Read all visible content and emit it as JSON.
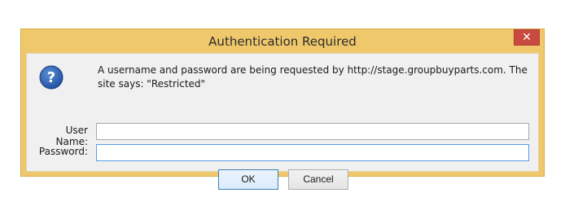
{
  "dialog": {
    "title": "Authentication Required",
    "close_glyph": "✕",
    "message": "A username and password are being requested by http://stage.groupbuyparts.com. The site says: \"Restricted\"",
    "icon": "question-icon",
    "fields": {
      "username_label": "User Name:",
      "username_value": "",
      "password_label": "Password:",
      "password_value": ""
    },
    "buttons": {
      "ok_label": "OK",
      "cancel_label": "Cancel"
    }
  },
  "colors": {
    "frame": "#f0c86c",
    "close_button": "#c94a40",
    "client_bg": "#f0f0f0",
    "focus_border": "#569de5"
  }
}
